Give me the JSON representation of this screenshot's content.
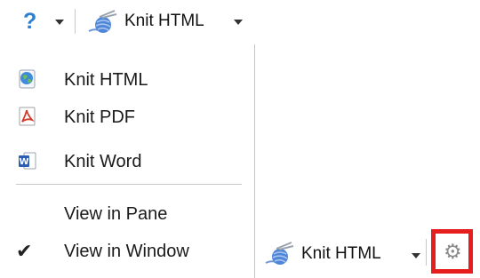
{
  "toolbar_top": {
    "help_icon": "?",
    "knit_label": "Knit HTML"
  },
  "menu": {
    "items": [
      {
        "label": "Knit HTML",
        "icon": "globe-icon"
      },
      {
        "label": "Knit PDF",
        "icon": "pdf-icon"
      },
      {
        "label": "Knit Word",
        "icon": "word-icon"
      },
      {
        "label": "View in Pane",
        "icon": ""
      },
      {
        "label": "View in Window",
        "icon": "checkmark-icon",
        "checked": true
      }
    ]
  },
  "toolbar_bottom": {
    "knit_label": "Knit HTML",
    "gear_icon": "⚙"
  },
  "colors": {
    "highlight_box": "#e61e1e",
    "help_blue": "#2f7fd1",
    "pdf_red": "#d33a2c",
    "word_blue": "#2b5fb3"
  }
}
